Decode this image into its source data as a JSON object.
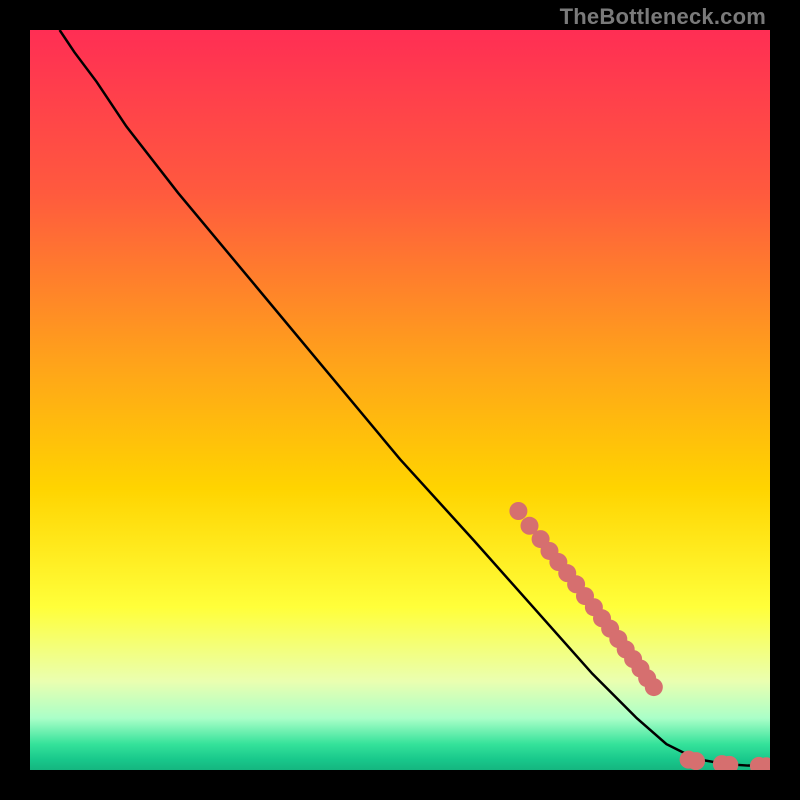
{
  "watermark": "TheBottleneck.com",
  "chart_data": {
    "type": "line",
    "title": "",
    "xlabel": "",
    "ylabel": "",
    "xlim": [
      0,
      100
    ],
    "ylim": [
      0,
      100
    ],
    "grid": false,
    "series": [
      {
        "name": "curve",
        "type": "line",
        "color": "#000000",
        "points": [
          {
            "x": 4,
            "y": 100
          },
          {
            "x": 6,
            "y": 97
          },
          {
            "x": 9,
            "y": 93
          },
          {
            "x": 13,
            "y": 87
          },
          {
            "x": 20,
            "y": 78
          },
          {
            "x": 30,
            "y": 66
          },
          {
            "x": 40,
            "y": 54
          },
          {
            "x": 50,
            "y": 42
          },
          {
            "x": 60,
            "y": 31
          },
          {
            "x": 68,
            "y": 22
          },
          {
            "x": 76,
            "y": 13
          },
          {
            "x": 82,
            "y": 7
          },
          {
            "x": 86,
            "y": 3.5
          },
          {
            "x": 90,
            "y": 1.5
          },
          {
            "x": 94,
            "y": 0.8
          },
          {
            "x": 97,
            "y": 0.6
          },
          {
            "x": 100,
            "y": 0.5
          }
        ]
      },
      {
        "name": "markers",
        "type": "scatter",
        "color": "#d66f6f",
        "radius": 9,
        "points": [
          {
            "x": 66,
            "y": 35
          },
          {
            "x": 67.5,
            "y": 33
          },
          {
            "x": 69,
            "y": 31.2
          },
          {
            "x": 70.2,
            "y": 29.6
          },
          {
            "x": 71.4,
            "y": 28.1
          },
          {
            "x": 72.6,
            "y": 26.6
          },
          {
            "x": 73.8,
            "y": 25.1
          },
          {
            "x": 75.0,
            "y": 23.5
          },
          {
            "x": 76.2,
            "y": 22.0
          },
          {
            "x": 77.3,
            "y": 20.5
          },
          {
            "x": 78.4,
            "y": 19.1
          },
          {
            "x": 79.5,
            "y": 17.7
          },
          {
            "x": 80.5,
            "y": 16.3
          },
          {
            "x": 81.5,
            "y": 15.0
          },
          {
            "x": 82.5,
            "y": 13.7
          },
          {
            "x": 83.4,
            "y": 12.4
          },
          {
            "x": 84.3,
            "y": 11.2
          },
          {
            "x": 89,
            "y": 1.4
          },
          {
            "x": 90,
            "y": 1.2
          },
          {
            "x": 93.5,
            "y": 0.8
          },
          {
            "x": 94.5,
            "y": 0.7
          },
          {
            "x": 98.5,
            "y": 0.55
          },
          {
            "x": 99.5,
            "y": 0.5
          }
        ]
      }
    ],
    "gradient_stops": [
      {
        "offset": 0.0,
        "color": "#ff2e54"
      },
      {
        "offset": 0.22,
        "color": "#ff5a3e"
      },
      {
        "offset": 0.45,
        "color": "#ffa31a"
      },
      {
        "offset": 0.62,
        "color": "#ffd400"
      },
      {
        "offset": 0.78,
        "color": "#ffff3a"
      },
      {
        "offset": 0.88,
        "color": "#eaffb0"
      },
      {
        "offset": 0.93,
        "color": "#aaffc8"
      },
      {
        "offset": 0.965,
        "color": "#35e29a"
      },
      {
        "offset": 0.985,
        "color": "#19c98c"
      },
      {
        "offset": 1.0,
        "color": "#15b57f"
      }
    ]
  }
}
